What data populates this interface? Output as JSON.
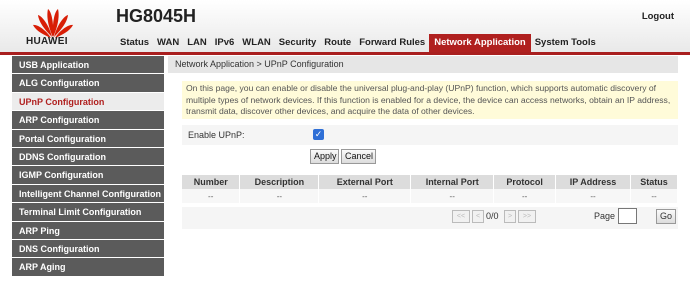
{
  "header": {
    "brand": "HUAWEI",
    "model": "HG8045H",
    "logout_label": "Logout",
    "accent_color": "#b0201f",
    "nav": [
      {
        "label": "Status"
      },
      {
        "label": "WAN"
      },
      {
        "label": "LAN"
      },
      {
        "label": "IPv6"
      },
      {
        "label": "WLAN"
      },
      {
        "label": "Security"
      },
      {
        "label": "Route"
      },
      {
        "label": "Forward Rules"
      },
      {
        "label": "Network Application",
        "active": true
      },
      {
        "label": "System Tools"
      }
    ]
  },
  "sidebar": {
    "items": [
      {
        "label": "USB Application"
      },
      {
        "label": "ALG Configuration"
      },
      {
        "label": "UPnP Configuration",
        "active": true
      },
      {
        "label": "ARP Configuration"
      },
      {
        "label": "Portal Configuration"
      },
      {
        "label": "DDNS Configuration"
      },
      {
        "label": "IGMP Configuration"
      },
      {
        "label": "Intelligent Channel Configuration"
      },
      {
        "label": "Terminal Limit Configuration"
      },
      {
        "label": "ARP Ping"
      },
      {
        "label": "DNS Configuration"
      },
      {
        "label": "ARP Aging"
      }
    ]
  },
  "main": {
    "breadcrumb": "Network Application > UPnP Configuration",
    "info_text": "On this page, you can enable or disable the universal plug-and-play (UPnP) function, which supports automatic discovery of multiple types of network devices. If this function is enabled for a device, the device can access networks, obtain an IP address, transmit data, discover other devices, and acquire the data of other devices.",
    "enable_label": "Enable UPnP:",
    "enable_checked": true,
    "apply_label": "Apply",
    "cancel_label": "Cancel",
    "table": {
      "columns": [
        "Number",
        "Description",
        "External Port",
        "Internal Port",
        "Protocol",
        "IP Address",
        "Status"
      ],
      "row": [
        "--",
        "--",
        "--",
        "--",
        "--",
        "--",
        "--"
      ]
    },
    "pager": {
      "first": "<<",
      "prev": "<",
      "info": "0/0",
      "next": ">",
      "last": ">>",
      "page_label": "Page",
      "page_value": "",
      "go_label": "Go"
    }
  }
}
